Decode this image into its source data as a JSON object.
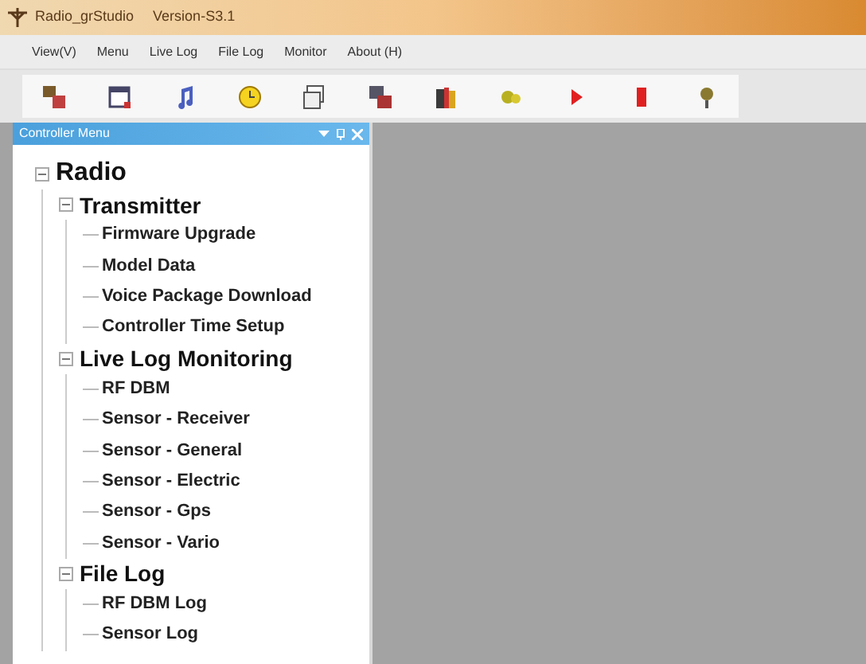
{
  "window": {
    "title": "Radio_grStudio",
    "version": "Version-S3.1"
  },
  "menu": [
    "View(V)",
    "Menu",
    "Live Log",
    "File Log",
    "Monitor",
    "About (H)"
  ],
  "panel": {
    "title": "Controller Menu"
  },
  "tree": [
    {
      "label": "Radio",
      "expanded": true,
      "children": [
        {
          "label": "Transmitter",
          "expanded": true,
          "children": [
            {
              "label": "Firmware Upgrade"
            },
            {
              "label": "Model Data"
            },
            {
              "label": "Voice Package Download"
            },
            {
              "label": "Controller Time Setup"
            }
          ]
        },
        {
          "label": "Live Log Monitoring",
          "expanded": true,
          "children": [
            {
              "label": "RF DBM"
            },
            {
              "label": "Sensor - Receiver"
            },
            {
              "label": "Sensor - General"
            },
            {
              "label": "Sensor - Electric"
            },
            {
              "label": "Sensor - Gps"
            },
            {
              "label": "Sensor - Vario"
            }
          ]
        },
        {
          "label": "File Log",
          "expanded": true,
          "children": [
            {
              "label": "RF DBM Log"
            },
            {
              "label": "Sensor Log"
            }
          ]
        }
      ]
    }
  ]
}
